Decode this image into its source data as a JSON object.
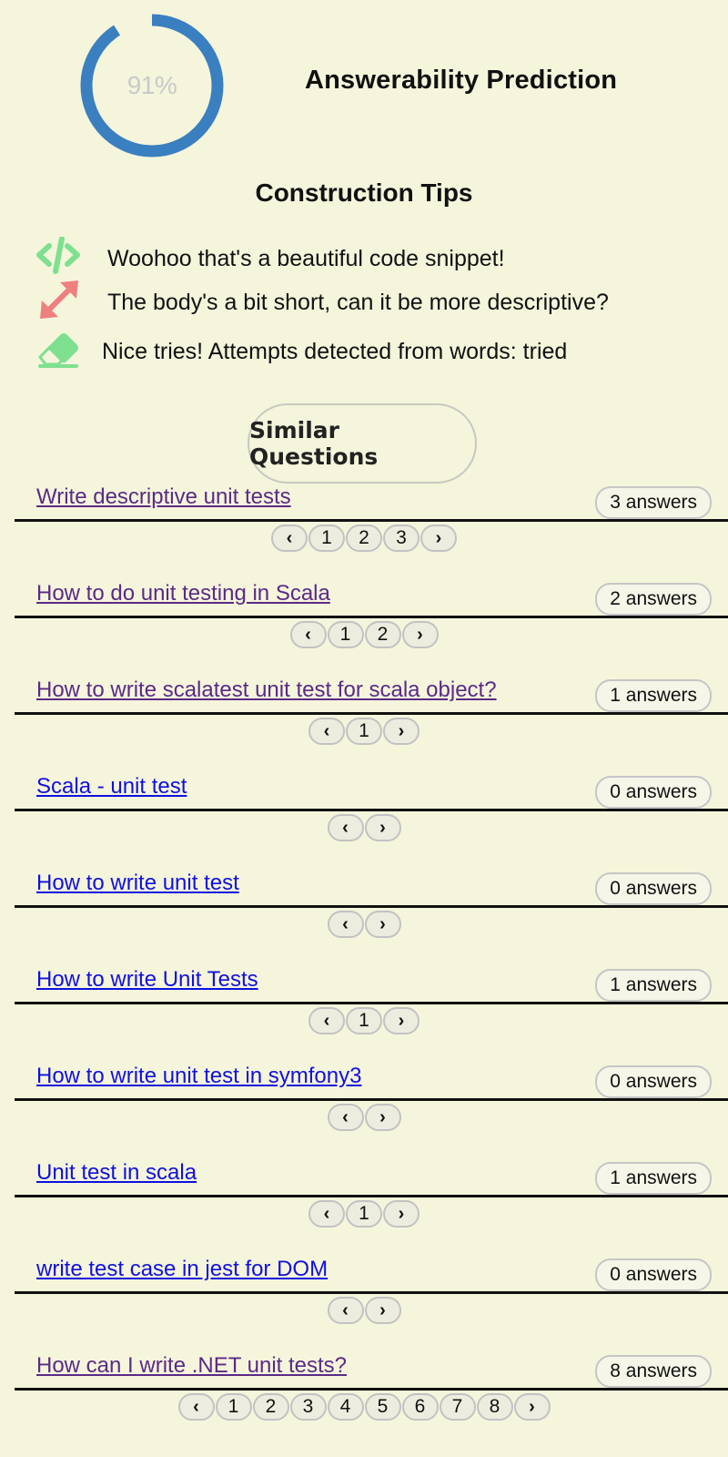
{
  "prediction": {
    "percent_label": "91%",
    "value": 0.91,
    "title": "Answerability Prediction",
    "ring_color": "#3a7fc0"
  },
  "tips": {
    "title": "Construction Tips",
    "items": [
      {
        "icon": "code-icon",
        "color": "#7ee08f",
        "text": "Woohoo that's a beautiful code snippet!"
      },
      {
        "icon": "resize-arrows-icon",
        "color": "#ee8080",
        "text": "The body's a bit short, can it be more descriptive?"
      },
      {
        "icon": "eraser-icon",
        "color": "#7ee08f",
        "text": "Nice tries! Attempts detected from words: tried"
      }
    ]
  },
  "similar_button": "Similar Questions",
  "pager": {
    "prev": "‹",
    "next": "›"
  },
  "questions": [
    {
      "title": "Write descriptive unit tests",
      "answers": "3 answers",
      "visited": true,
      "pages": [
        "1",
        "2",
        "3"
      ]
    },
    {
      "title": "How to do unit testing in Scala",
      "answers": "2 answers",
      "visited": true,
      "pages": [
        "1",
        "2"
      ]
    },
    {
      "title": "How to write scalatest unit test for scala object?",
      "answers": "1 answers",
      "visited": true,
      "pages": [
        "1"
      ]
    },
    {
      "title": "Scala - unit test",
      "answers": "0 answers",
      "visited": false,
      "pages": []
    },
    {
      "title": "How to write unit test",
      "answers": "0 answers",
      "visited": false,
      "pages": []
    },
    {
      "title": "How to write Unit Tests",
      "answers": "1 answers",
      "visited": false,
      "pages": [
        "1"
      ]
    },
    {
      "title": "How to write unit test in symfony3",
      "answers": "0 answers",
      "visited": false,
      "pages": []
    },
    {
      "title": "Unit test in scala",
      "answers": "1 answers",
      "visited": false,
      "pages": [
        "1"
      ]
    },
    {
      "title": "write test case in jest for DOM",
      "answers": "0 answers",
      "visited": false,
      "pages": []
    },
    {
      "title": "How can I write .NET unit tests?",
      "answers": "8 answers",
      "visited": true,
      "pages": [
        "1",
        "2",
        "3",
        "4",
        "5",
        "6",
        "7",
        "8"
      ]
    }
  ]
}
